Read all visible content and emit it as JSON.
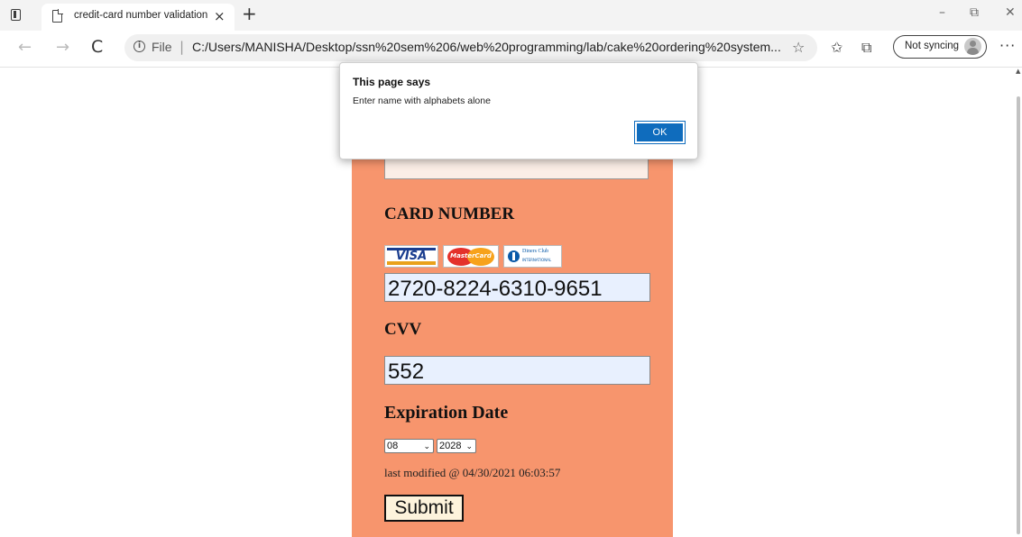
{
  "browser": {
    "tab_title": "credit-card number validation",
    "tab_close": "×",
    "new_tab": "+",
    "window_controls": {
      "minimize": "–",
      "restore": "⧉",
      "close": "✕"
    },
    "nav": {
      "back": "←",
      "forward": "→",
      "refresh": "C"
    },
    "address": {
      "protocol": "File",
      "separator": "|",
      "url": "C:/Users/MANISHA/Desktop/ssn%20sem%206/web%20programming/lab/cake%20ordering%20system..."
    },
    "toolbar_icons": [
      "favorite-icon",
      "favorites-list-icon",
      "collections-icon"
    ],
    "sync_label": "Not syncing",
    "more": "···"
  },
  "form": {
    "card_heading": "CARD NUMBER",
    "card_logos": {
      "visa": "VISA",
      "mastercard": "MasterCard",
      "diners": "Diners Club",
      "diners_sub": "INTERNATIONAL"
    },
    "card_number": "2720-8224-6310-9651",
    "cvv_heading": "CVV",
    "cvv": "552",
    "expiration_heading": "Expiration Date",
    "exp_month": "08",
    "exp_year": "2028",
    "last_modified": "last modified @ 04/30/2021 06:03:57",
    "submit_label": "Submit",
    "panel_color": "#f7956d"
  },
  "dialog": {
    "title": "This page says",
    "message": "Enter name with alphabets alone",
    "ok_label": "OK",
    "accent": "#0f6cbd"
  }
}
